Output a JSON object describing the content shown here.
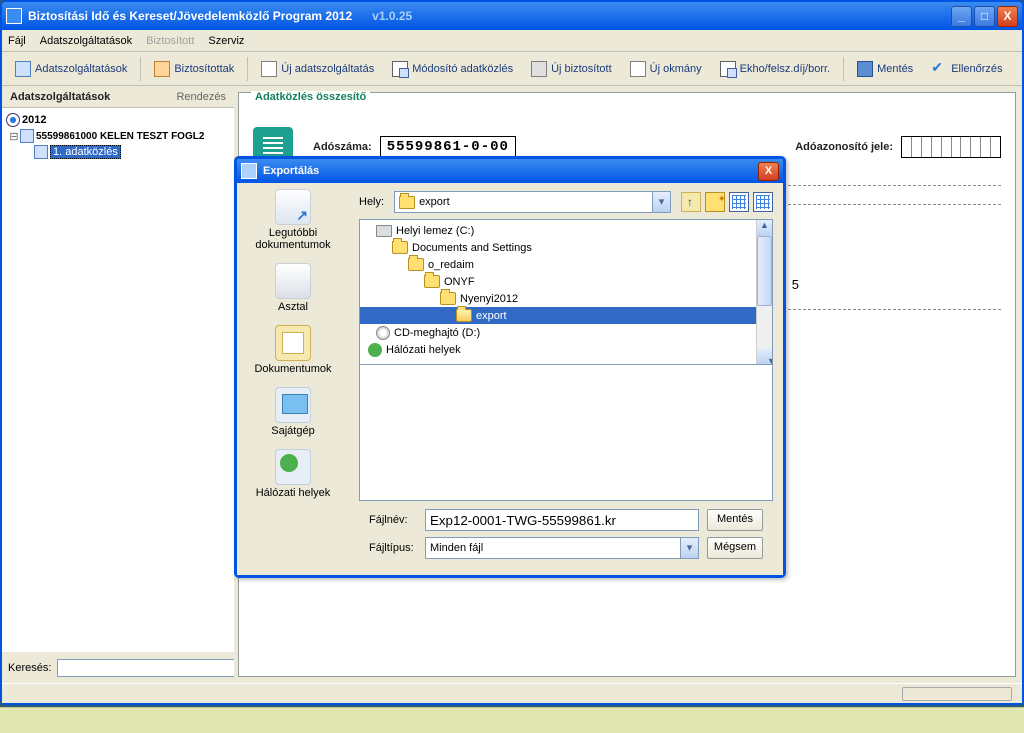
{
  "window": {
    "title": "Biztosítási Idő és Kereset/Jövedelemközlő Program 2012",
    "version": "v1.0.25"
  },
  "menu": {
    "file": "Fájl",
    "services": "Adatszolgáltatások",
    "insured": "Biztosított",
    "service": "Szerviz"
  },
  "toolbar": {
    "services": "Adatszolgáltatások",
    "insured_list": "Biztosítottak",
    "new_service": "Új adatszolgáltatás",
    "modify_data": "Módosító adatközlés",
    "new_insured": "Új biztosított",
    "new_doc": "Új okmány",
    "ekho": "Ekho/felsz.díj/borr.",
    "save": "Mentés",
    "check": "Ellenőrzés"
  },
  "sidebar": {
    "head": "Adatszolgáltatások",
    "sort": "Rendezés",
    "tree": {
      "year": "2012",
      "company": "55599861000 KELEN TESZT FOGL2",
      "item1": "1. adatközlés"
    },
    "search_lbl": "Keresés:"
  },
  "panel": {
    "legend": "Adatközlés összesítő",
    "tax_label": "Adószáma:",
    "tax_value": "55599861-0-00",
    "id_label": "Adóazonosító jele:",
    "stray": "5"
  },
  "dialog": {
    "title": "Exportálás",
    "places": {
      "recent": "Legutóbbi dokumentumok",
      "desktop": "Asztal",
      "docs": "Dokumentumok",
      "pc": "Sajátgép",
      "net": "Hálózati helyek"
    },
    "location_lbl": "Hely:",
    "location_val": "export",
    "tree": {
      "drive_c": "Helyi lemez (C:)",
      "docs_settings": "Documents and Settings",
      "o_redaim": "o_redaim",
      "onyf": "ONYF",
      "nyenyi": "Nyenyi2012",
      "export": "export",
      "cd": "CD-meghajtó (D:)",
      "net": "Hálózati helyek"
    },
    "filename_lbl": "Fájlnév:",
    "filename_val": "Exp12-0001-TWG-55599861.kr",
    "filetype_lbl": "Fájltípus:",
    "filetype_val": "Minden fájl",
    "save_btn": "Mentés",
    "cancel_btn": "Mégsem"
  }
}
